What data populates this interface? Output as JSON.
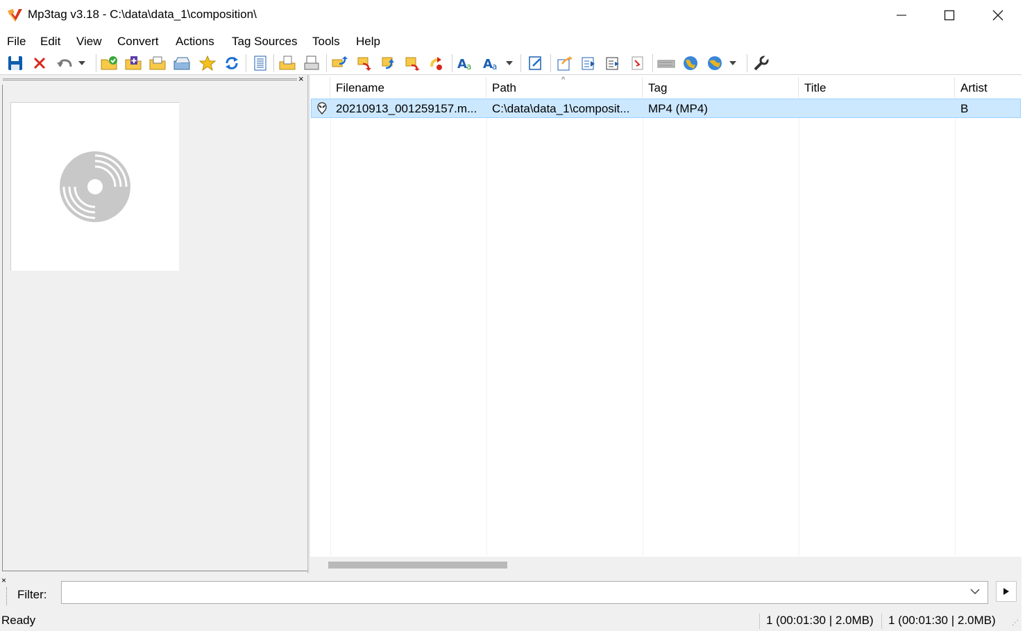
{
  "window": {
    "title": "Mp3tag v3.18  -  C:\\data\\data_1\\composition\\",
    "minimize_icon": "minimize-icon",
    "maximize_icon": "maximize-icon",
    "close_icon": "close-icon"
  },
  "menu": [
    "File",
    "Edit",
    "View",
    "Convert",
    "Actions",
    "Tag Sources",
    "Tools",
    "Help"
  ],
  "toolbar": {
    "icons": [
      "save-icon",
      "remove-tag-icon",
      "undo-icon",
      "undo-dropdown-icon",
      "change-directory-icon",
      "add-directory-icon",
      "open-file-icon",
      "favorites-folder-icon",
      "favorites-star-icon",
      "refresh-icon",
      "select-all-icon",
      "filename-to-tag-icon",
      "tag-to-filename-icon",
      "tag-to-tag-icon",
      "text-file-to-tag-icon",
      "tag-to-textfile-icon",
      "export-icon",
      "actions-icon",
      "actions-quick-icon",
      "actions-dropdown-icon",
      "autonumbering-icon",
      "playlist-icon",
      "extended-tags-icon",
      "case-conversion-icon",
      "freedb-icon",
      "web-sources-icon",
      "web-sources-dropdown-icon",
      "options-wrench-icon"
    ]
  },
  "colors": {
    "accent": "#cce8ff",
    "accent_border": "#99d1ff",
    "folder_yellow": "#f7c948",
    "save_blue": "#0b5cad",
    "close_red": "#d8261a"
  },
  "columns": [
    "Filename",
    "Path",
    "Tag",
    "Title",
    "Artist"
  ],
  "rows": [
    {
      "filename": "20210913_001259157.m...",
      "path": "C:\\data\\data_1\\composit...",
      "tag": "MP4 (MP4)",
      "title": "",
      "artist": "B"
    }
  ],
  "filter": {
    "label": "Filter:",
    "value": ""
  },
  "status": {
    "left": "Ready",
    "selected": "1 (00:01:30 | 2.0MB)",
    "total": "1 (00:01:30 | 2.0MB)"
  }
}
